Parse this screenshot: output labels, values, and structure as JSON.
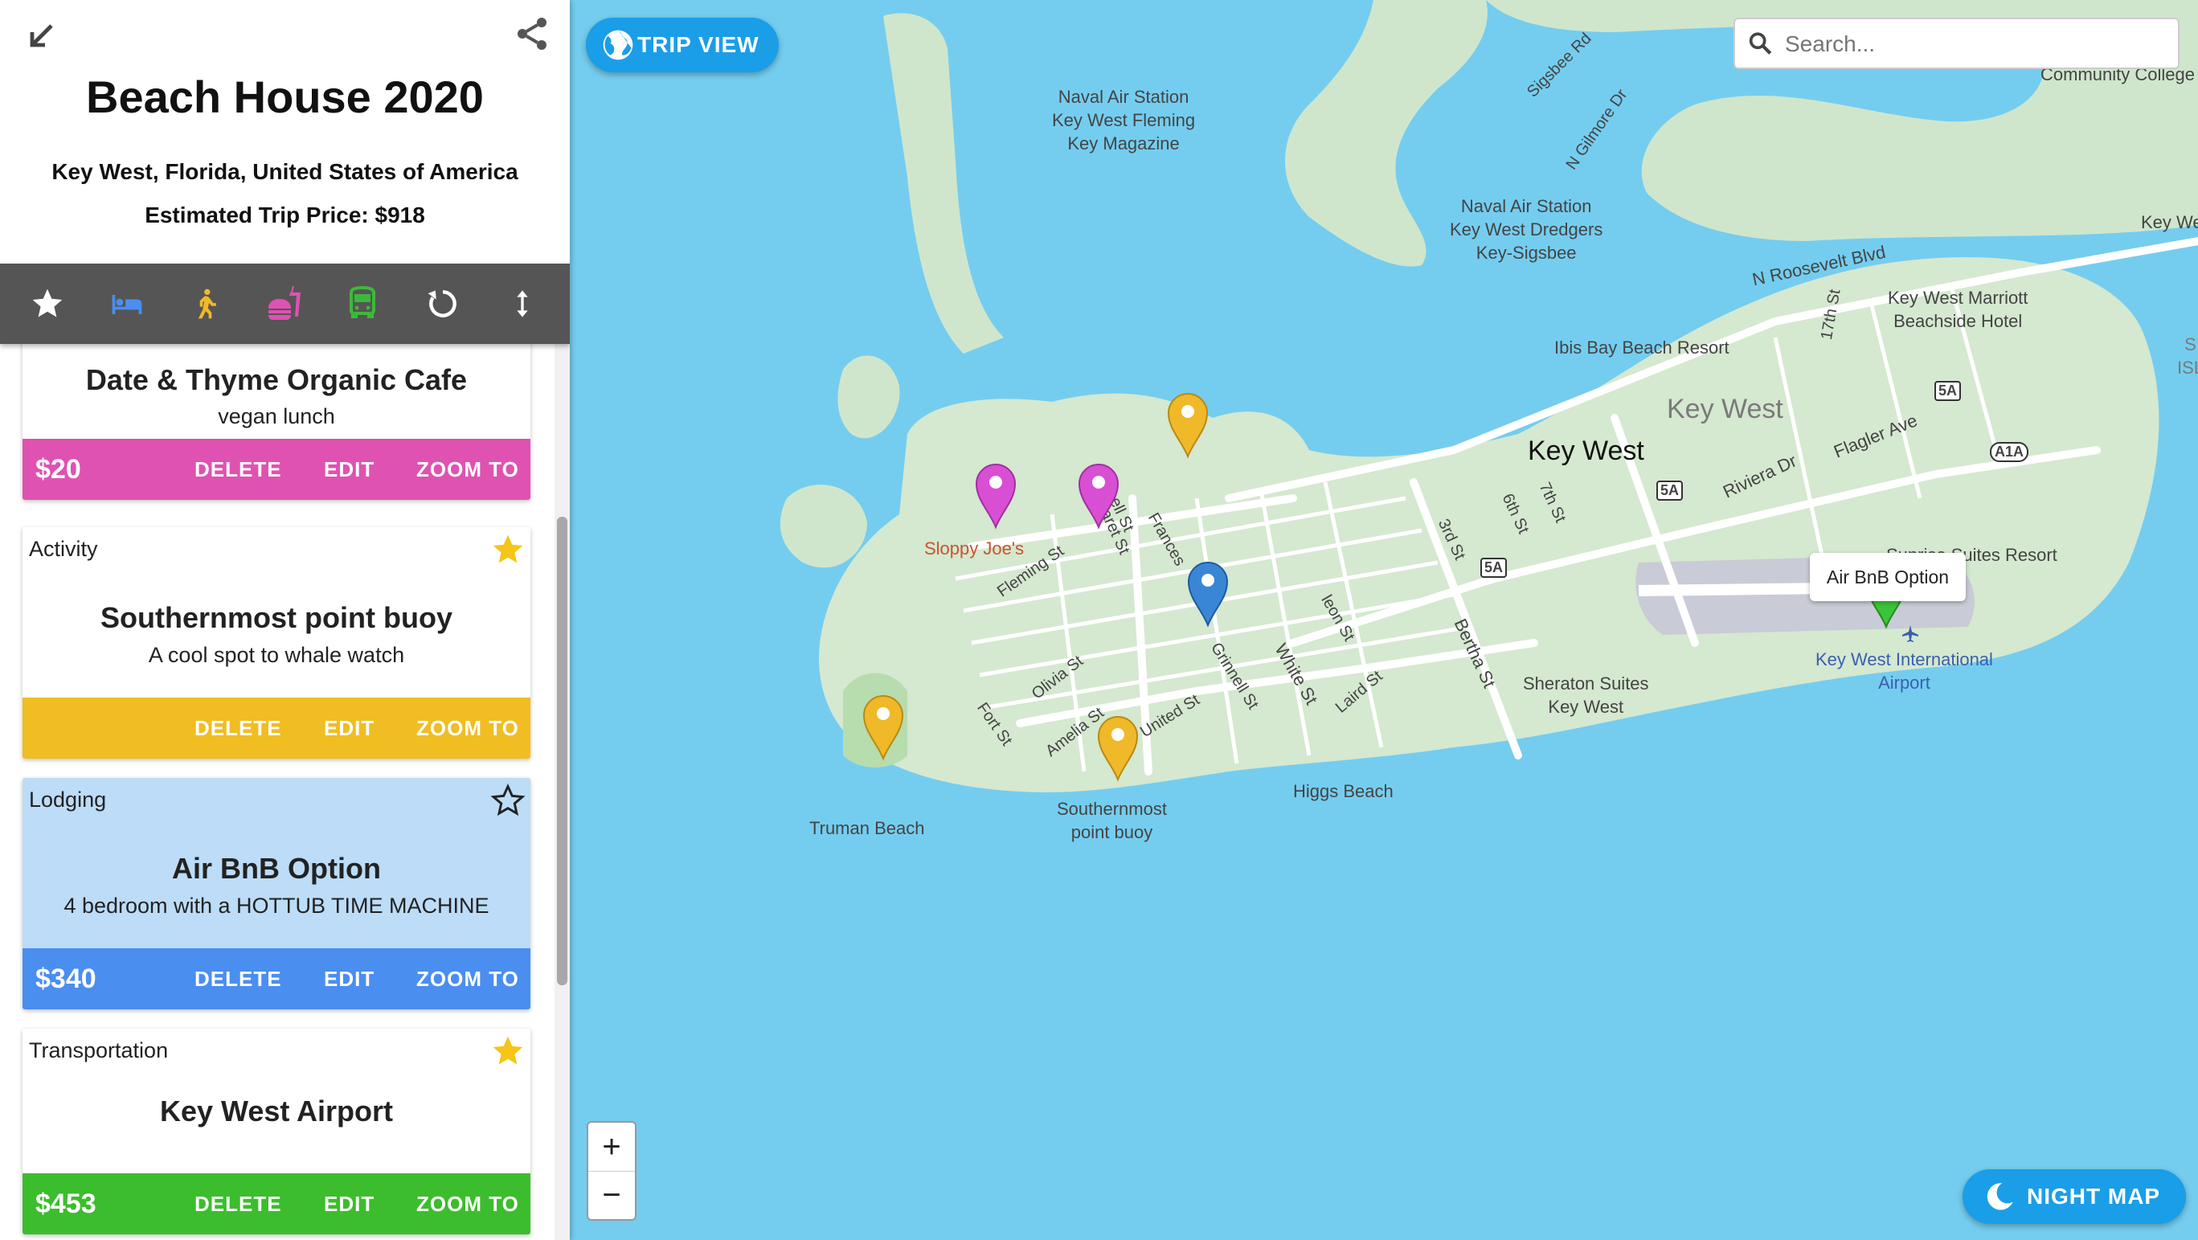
{
  "trip": {
    "title": "Beach House 2020",
    "location": "Key West, Florida, United States of America",
    "price": "Estimated Trip Price: $918"
  },
  "toolbar": {
    "items": [
      {
        "icon": "star-icon",
        "color": "#ffffff"
      },
      {
        "icon": "bed-icon",
        "color": "#4a8ef0"
      },
      {
        "icon": "walking-person-icon",
        "color": "#f0b92a"
      },
      {
        "icon": "fastfood-icon",
        "color": "#e051b3"
      },
      {
        "icon": "bus-icon",
        "color": "#3cb93b"
      },
      {
        "icon": "history-icon",
        "color": "#ffffff"
      },
      {
        "icon": "vertical-arrows-icon",
        "color": "#ffffff"
      }
    ]
  },
  "actions": {
    "delete": "DELETE",
    "edit": "EDIT",
    "zoom": "ZOOM TO"
  },
  "cards": [
    {
      "category": "",
      "title": "Date & Thyme Organic Cafe",
      "description": "vegan lunch",
      "price": "$20",
      "color": "#e052b1",
      "bg": "#ffffff",
      "starred": false
    },
    {
      "category": "Activity",
      "title": "Southernmost point buoy",
      "description": "A cool spot to whale watch",
      "price": "",
      "color": "#f0bd22",
      "bg": "#ffffff",
      "starred": true
    },
    {
      "category": "Lodging",
      "title": "Air BnB Option",
      "description": "4 bedroom with a HOTTUB TIME MACHINE",
      "price": "$340",
      "color": "#4a8ef0",
      "bg": "#bcdcf7",
      "starred": false
    },
    {
      "category": "Transportation",
      "title": "Key West Airport",
      "description": "",
      "price": "$453",
      "color": "#3cbd2d",
      "bg": "#ffffff",
      "starred": true
    }
  ],
  "map": {
    "trip_view_label": "TRIP VIEW",
    "search_placeholder": "Search...",
    "night_map_label": "NIGHT MAP",
    "popup": "Air BnB Option",
    "zoom_in": "+",
    "zoom_out": "−",
    "labels": {
      "naval_air_station_fleming": "Naval Air Station\nKey West Fleming\nKey Magazine",
      "naval_air_station_dredgers": "Naval Air Station\nKey West Dredgers\nKey-Sigsbee",
      "sigsbee_rd": "Sigsbee Rd",
      "n_gilmore_dr": "N Gilmore Dr",
      "community_college": "Community College",
      "key_west_ne": "Key We",
      "n_roosevelt_blvd": "N Roosevelt Blvd",
      "marriott": "Key West Marriott\nBeachside Hotel",
      "ibis_bay": "Ibis Bay Beach Resort",
      "key_west_district": "Key West",
      "key_west_city": "Key West",
      "flagler_ave": "Flagler Ave",
      "riviera_dr": "Riviera Dr",
      "sunrise_suites": "Sunrise Suites Resort",
      "airport": "Key West International\nAirport",
      "sheraton": "Sheraton Suites\nKey West",
      "higgs_beach": "Higgs Beach",
      "truman_beach": "Truman Beach",
      "southernmost": "Southernmost\npoint buoy",
      "sloppy_joes": "Sloppy Joe's",
      "fleming_st": "Fleming St",
      "olivia_st": "Olivia St",
      "fort_st": "Fort St",
      "amelia_st": "Amelia St",
      "united_st": "United St",
      "grinnell_st": "Grinnell St",
      "white_st": "White St",
      "laird_st": "Laird St",
      "bertha_st": "Bertha St",
      "third_st": "3rd St",
      "sixth_st": "6th St",
      "seventh_st": "7th St",
      "seventeenth_st": "17th St",
      "margaret_st": "Margaret St",
      "frances": "Frances",
      "simonton_st": "nell St",
      "leon_st": "leon St",
      "shield_5a_1": "5A",
      "shield_5a_2": "5A",
      "shield_5a_3": "5A",
      "shield_a1a": "A1A",
      "si": "S\nISL"
    }
  }
}
